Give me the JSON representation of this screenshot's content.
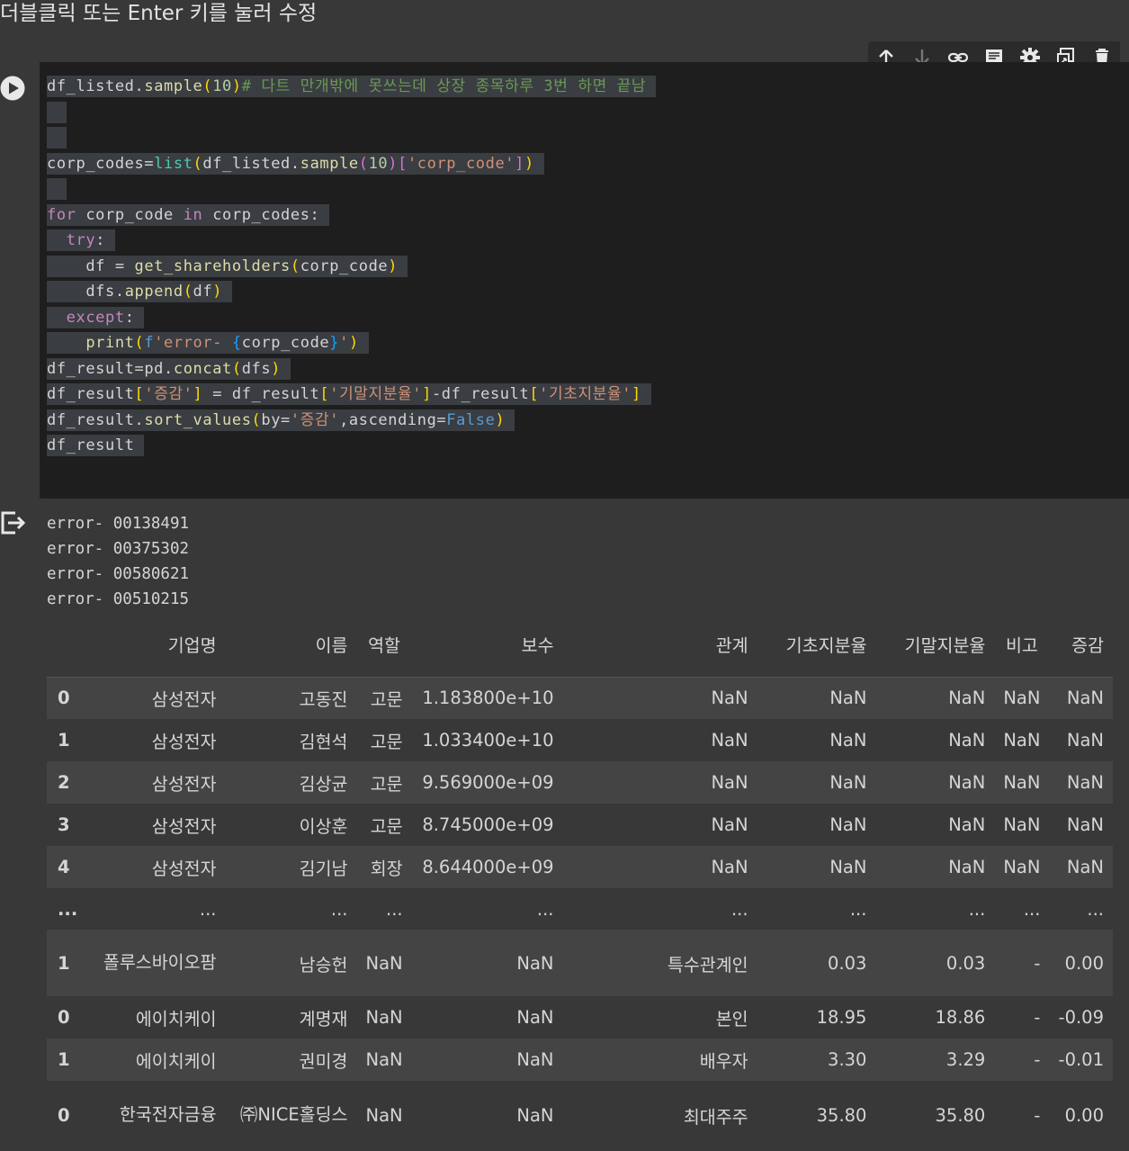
{
  "hint_text": "더블클릭 또는 Enter 키를 눌러 수정",
  "toolbar": {
    "icons": [
      "arrow-up-icon",
      "arrow-down-icon",
      "link-icon",
      "comment-icon",
      "gear-icon",
      "mirror-cell-icon",
      "trash-icon"
    ]
  },
  "output_lines": [
    "error- 00138491",
    "error- 00375302",
    "error- 00580621",
    "error- 00510215"
  ],
  "table": {
    "columns": [
      "기업명",
      "이름",
      "역할",
      "보수",
      "관계",
      "기초지분율",
      "기말지분율",
      "비고",
      "증감"
    ],
    "rows": [
      {
        "index": "0",
        "cells": [
          "삼성전자",
          "고동진",
          "고문",
          "1.183800e+10",
          "NaN",
          "NaN",
          "NaN",
          "NaN",
          "NaN"
        ]
      },
      {
        "index": "1",
        "cells": [
          "삼성전자",
          "김현석",
          "고문",
          "1.033400e+10",
          "NaN",
          "NaN",
          "NaN",
          "NaN",
          "NaN"
        ]
      },
      {
        "index": "2",
        "cells": [
          "삼성전자",
          "김상균",
          "고문",
          "9.569000e+09",
          "NaN",
          "NaN",
          "NaN",
          "NaN",
          "NaN"
        ]
      },
      {
        "index": "3",
        "cells": [
          "삼성전자",
          "이상훈",
          "고문",
          "8.745000e+09",
          "NaN",
          "NaN",
          "NaN",
          "NaN",
          "NaN"
        ]
      },
      {
        "index": "4",
        "cells": [
          "삼성전자",
          "김기남",
          "회장",
          "8.644000e+09",
          "NaN",
          "NaN",
          "NaN",
          "NaN",
          "NaN"
        ]
      },
      {
        "index": "...",
        "cells": [
          "...",
          "...",
          "...",
          "...",
          "...",
          "...",
          "...",
          "...",
          "..."
        ]
      },
      {
        "index": "1",
        "cells": [
          "폴루스바이오팜",
          "남승헌",
          "NaN",
          "NaN",
          "특수관계인",
          "0.03",
          "0.03",
          "-",
          "0.00"
        ]
      },
      {
        "index": "0",
        "cells": [
          "에이치케이",
          "계명재",
          "NaN",
          "NaN",
          "본인",
          "18.95",
          "18.86",
          "-",
          "-0.09"
        ]
      },
      {
        "index": "1",
        "cells": [
          "에이치케이",
          "권미경",
          "NaN",
          "NaN",
          "배우자",
          "3.30",
          "3.29",
          "-",
          "-0.01"
        ]
      },
      {
        "index": "0",
        "cells": [
          "한국전자금융",
          "㈜NICE홀딩스",
          "NaN",
          "NaN",
          "최대주주",
          "35.80",
          "35.80",
          "-",
          "0.00"
        ]
      }
    ]
  }
}
